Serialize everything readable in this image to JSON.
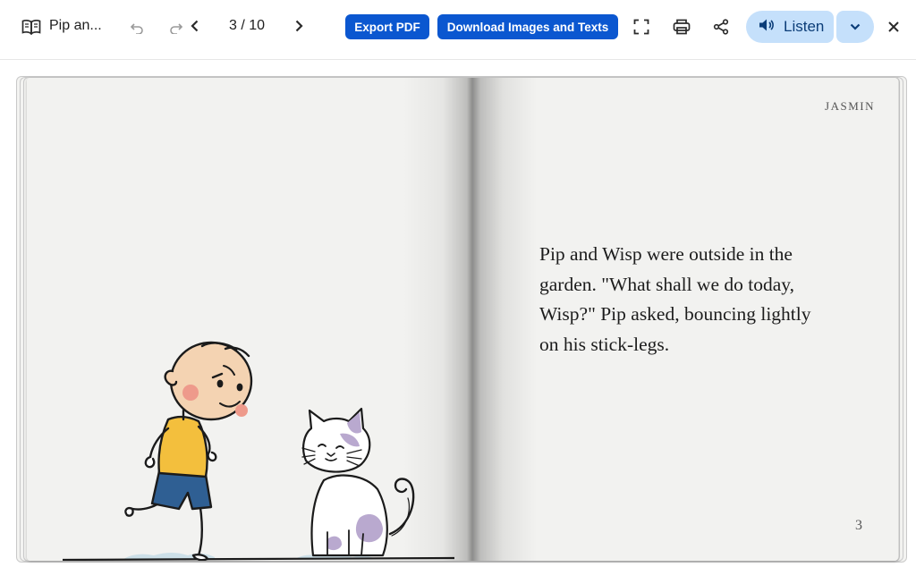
{
  "toolbar": {
    "book_icon": "open-book-icon",
    "title": "Pip an...",
    "page_indicator": "3 / 10",
    "export_pdf_label": "Export PDF",
    "download_label": "Download Images and Texts",
    "listen_label": "Listen",
    "icons": {
      "undo": "undo-icon",
      "redo": "redo-icon",
      "prev": "chevron-left-icon",
      "next": "chevron-right-icon",
      "fullscreen": "fullscreen-icon",
      "print": "printer-icon",
      "share": "share-icon",
      "speaker": "speaker-icon",
      "dropdown": "chevron-down-icon",
      "close": "close-icon"
    },
    "colors": {
      "primary": "#0b57d0",
      "listen_bg": "#c5e0fb",
      "listen_text": "#0b3d78"
    }
  },
  "book": {
    "author": "JASMIN",
    "story_text": "Pip and Wisp were outside in the garden. \"What shall we do today, Wisp?\" Pip asked, bouncing lightly on his stick-legs.",
    "page_number": "3",
    "illustration": {
      "subjects": [
        "boy-pip",
        "cat-wisp"
      ],
      "colors": {
        "shirt": "#f3bf3d",
        "shorts": "#2f5f93",
        "cat_patches": "#b9a9cf",
        "ground": "#c3dbe6"
      }
    }
  }
}
